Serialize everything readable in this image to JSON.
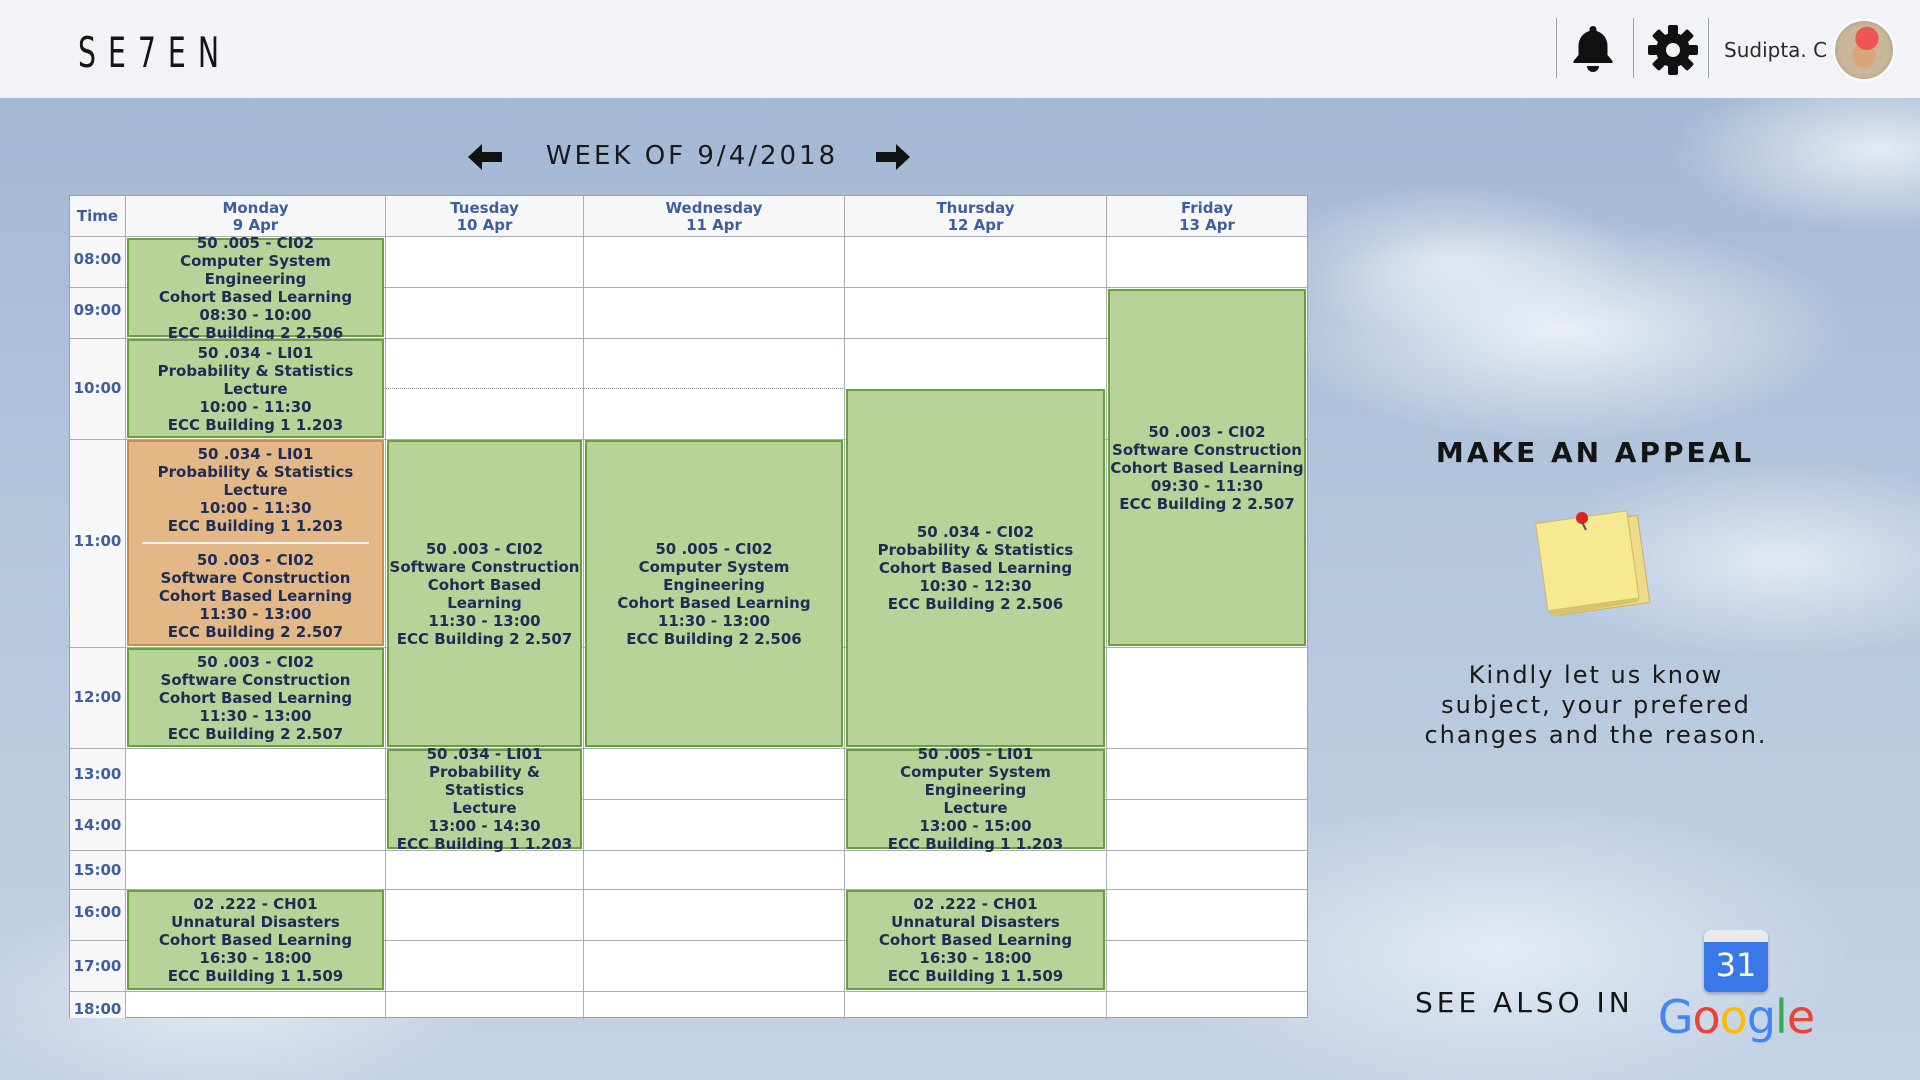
{
  "app": {
    "logo": "SE7EN"
  },
  "header": {
    "user_name": "Sudipta. C"
  },
  "week_nav": {
    "label": "WEEK OF 9/4/2018"
  },
  "timetable": {
    "time_header": "Time",
    "days": [
      {
        "name": "Monday",
        "date": "9 Apr"
      },
      {
        "name": "Tuesday",
        "date": "10 Apr"
      },
      {
        "name": "Wednesday",
        "date": "11 Apr"
      },
      {
        "name": "Thursday",
        "date": "12 Apr"
      },
      {
        "name": "Friday",
        "date": "13 Apr"
      }
    ],
    "times": [
      "08:00",
      "09:00",
      "10:00",
      "11:00",
      "12:00",
      "13:00",
      "14:00",
      "15:00",
      "16:00",
      "17:00",
      "18:00"
    ],
    "events": {
      "mon_0830": [
        "50 .005 - CI02",
        "Computer System Engineering",
        "Cohort Based Learning",
        "08:30 - 10:00",
        "ECC Building 2 2.506"
      ],
      "mon_1000": [
        "50 .034 - LI01",
        "Probability & Statistics",
        "Lecture",
        "10:00 - 11:30",
        "ECC Building 1 1.203"
      ],
      "mon_clash_a": [
        "50 .034 - LI01",
        "Probability & Statistics",
        "Lecture",
        "10:00 - 11:30",
        "ECC Building 1 1.203"
      ],
      "mon_clash_b": [
        "50 .003 - CI02",
        "Software Construction",
        "Cohort Based Learning",
        "11:30 - 13:00",
        "ECC Building 2 2.507"
      ],
      "mon_1130": [
        "50 .003 - CI02",
        "Software Construction",
        "Cohort Based Learning",
        "11:30 - 13:00",
        "ECC Building 2 2.507"
      ],
      "mon_1630": [
        "02 .222 - CH01",
        "Unnatural Disasters",
        "Cohort Based Learning",
        "16:30 - 18:00",
        "ECC Building 1 1.509"
      ],
      "tue_1130": [
        "50 .003 - CI02",
        "Software Construction",
        "Cohort Based Learning",
        "11:30 - 13:00",
        "ECC Building 2 2.507"
      ],
      "tue_1300": [
        "50 .034 - LI01",
        "Probability & Statistics",
        "Lecture",
        "13:00 - 14:30",
        "ECC Building 1 1.203"
      ],
      "wed_1130": [
        "50 .005 - CI02",
        "Computer System Engineering",
        "Cohort Based Learning",
        "11:30 - 13:00",
        "ECC Building 2 2.506"
      ],
      "thu_1030": [
        "50 .034 - CI02",
        "Probability & Statistics",
        "Cohort Based Learning",
        "10:30 - 12:30",
        "ECC Building 2 2.506"
      ],
      "thu_1300": [
        "50 .005 - LI01",
        "Computer System Engineering",
        "Lecture",
        "13:00 - 15:00",
        "ECC Building 1 1.203"
      ],
      "thu_1630": [
        "02 .222 - CH01",
        "Unnatural Disasters",
        "Cohort Based Learning",
        "16:30 - 18:00",
        "ECC Building 1 1.509"
      ],
      "fri_0930": [
        "50 .003 - CI02",
        "Software Construction",
        "Cohort Based Learning",
        "09:30 - 11:30",
        "ECC Building 2 2.507"
      ]
    }
  },
  "appeal": {
    "title": "MAKE AN APPEAL",
    "text_lines": [
      "Kindly let us know",
      "subject, your prefered",
      "changes and the reason."
    ]
  },
  "see_also": {
    "label": "SEE ALSO IN",
    "calendar_day": "31",
    "google_letters": [
      {
        "ch": "G",
        "color": "#4285F4"
      },
      {
        "ch": "o",
        "color": "#EA4335"
      },
      {
        "ch": "o",
        "color": "#FBBC05"
      },
      {
        "ch": "g",
        "color": "#4285F4"
      },
      {
        "ch": "l",
        "color": "#34A853"
      },
      {
        "ch": "e",
        "color": "#EA4335"
      }
    ]
  },
  "colors": {
    "event_fill": "#b8d398",
    "event_border": "#6aa03c",
    "clash_fill": "#e3b886",
    "header_text": "#3d5f9e"
  }
}
